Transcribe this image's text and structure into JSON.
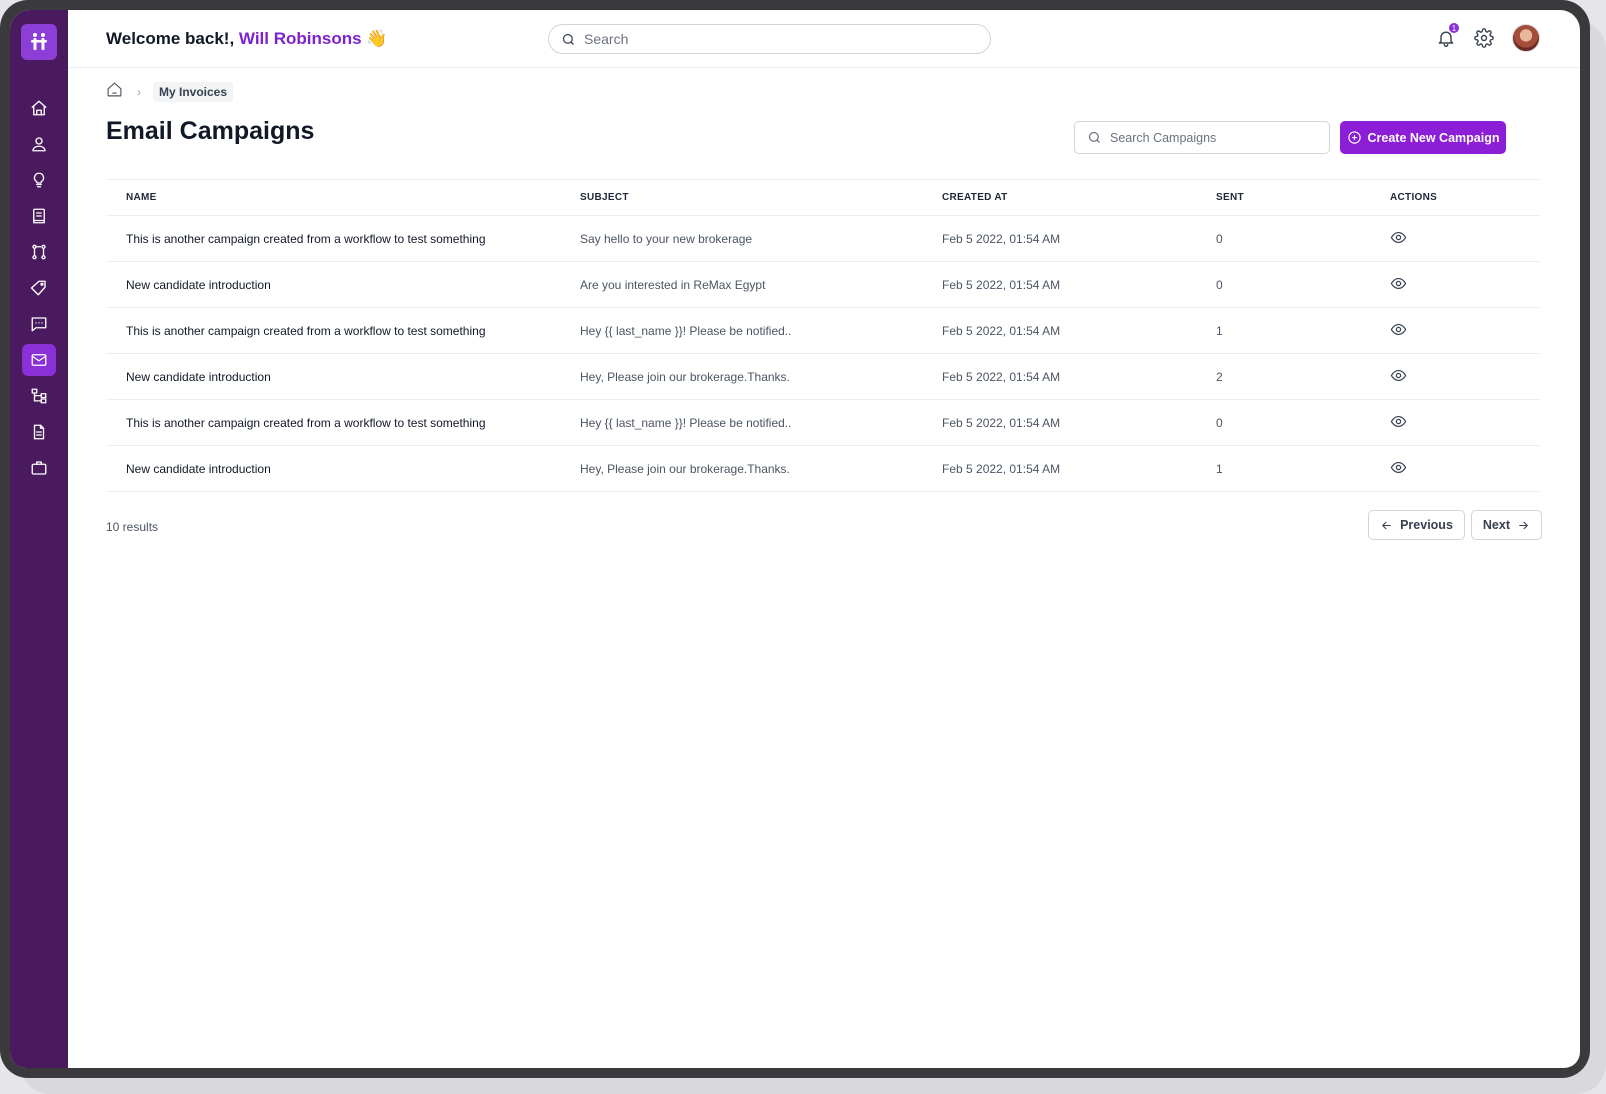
{
  "header": {
    "welcome_prefix": "Welcome back!,",
    "user_name": "Will Robinsons",
    "wave_emoji": "👋",
    "search_placeholder": "Search",
    "notification_count": "1"
  },
  "sidebar": {
    "items": [
      {
        "icon": "home-icon"
      },
      {
        "icon": "user-icon"
      },
      {
        "icon": "lightbulb-icon"
      },
      {
        "icon": "ledger-icon"
      },
      {
        "icon": "workflow-icon"
      },
      {
        "icon": "tag-icon"
      },
      {
        "icon": "chat-icon"
      },
      {
        "icon": "mail-icon",
        "active": true
      },
      {
        "icon": "hierarchy-icon"
      },
      {
        "icon": "document-icon"
      },
      {
        "icon": "briefcase-icon"
      }
    ],
    "colors": {
      "background": "#4a1a5e",
      "active": "#8b2fd6"
    }
  },
  "breadcrumb": {
    "current": "My Invoices"
  },
  "page": {
    "title": "Email Campaigns",
    "search_placeholder": "Search Campaigns",
    "create_label": "Create New Campaign",
    "accent_color": "#8b1ed6"
  },
  "table": {
    "headers": [
      "NAME",
      "SUBJECT",
      "CREATED AT",
      "SENT",
      "ACTIONS"
    ],
    "rows": [
      {
        "name": "This is another campaign created from a workflow to test something",
        "subject": "Say hello to your new brokerage",
        "created_at": "Feb 5 2022, 01:54 AM",
        "sent": "0"
      },
      {
        "name": "New candidate introduction",
        "subject": "Are you interested in ReMax Egypt",
        "created_at": "Feb 5 2022, 01:54 AM",
        "sent": "0"
      },
      {
        "name": "This is another campaign created from a workflow to test something",
        "subject": "Hey {{ last_name }}! Please be notified..",
        "created_at": "Feb 5 2022, 01:54 AM",
        "sent": "1"
      },
      {
        "name": "New candidate introduction",
        "subject": "Hey, Please join our brokerage.Thanks.",
        "created_at": "Feb 5 2022, 01:54 AM",
        "sent": "2"
      },
      {
        "name": "This is another campaign created from a workflow to test something",
        "subject": "Hey {{ last_name }}! Please be notified..",
        "created_at": "Feb 5 2022, 01:54 AM",
        "sent": "0"
      },
      {
        "name": "New candidate introduction",
        "subject": "Hey, Please join our brokerage.Thanks.",
        "created_at": "Feb 5 2022, 01:54 AM",
        "sent": "1"
      }
    ]
  },
  "pagination": {
    "results_text": "10 results",
    "previous_label": "Previous",
    "next_label": "Next"
  }
}
